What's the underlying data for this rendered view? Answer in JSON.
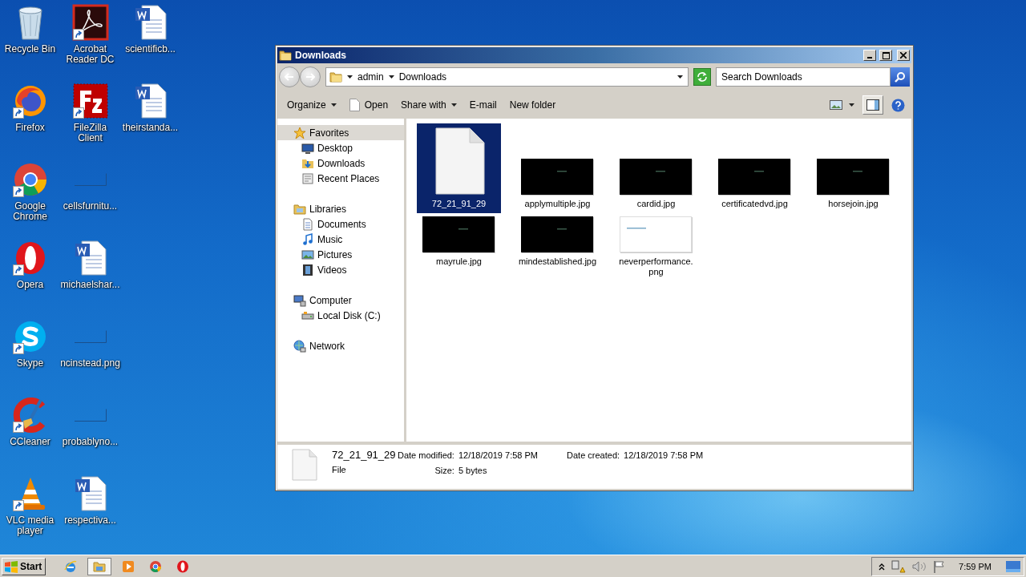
{
  "desktop_icons": [
    {
      "label": "Recycle Bin",
      "kind": "recycle_bin",
      "shortcut": false
    },
    {
      "label": "Firefox",
      "kind": "firefox",
      "shortcut": true
    },
    {
      "label": "Google Chrome",
      "kind": "chrome",
      "shortcut": true
    },
    {
      "label": "Opera",
      "kind": "opera",
      "shortcut": true
    },
    {
      "label": "Skype",
      "kind": "skype",
      "shortcut": true
    },
    {
      "label": "CCleaner",
      "kind": "ccleaner",
      "shortcut": true
    },
    {
      "label": "VLC media player",
      "kind": "vlc",
      "shortcut": true
    },
    {
      "label": "Acrobat Reader DC",
      "kind": "acrobat",
      "shortcut": true
    },
    {
      "label": "FileZilla Client",
      "kind": "filezilla",
      "shortcut": true
    },
    {
      "label": "cellsfurnitu...",
      "kind": "blank_image",
      "shortcut": false
    },
    {
      "label": "michaelshar...",
      "kind": "word",
      "shortcut": false
    },
    {
      "label": "ncinstead.png",
      "kind": "blank_image",
      "shortcut": false
    },
    {
      "label": "probablyno...",
      "kind": "blank_image",
      "shortcut": false
    },
    {
      "label": "respectiva...",
      "kind": "word",
      "shortcut": false
    },
    {
      "label": "scientificb...",
      "kind": "word",
      "shortcut": false
    },
    {
      "label": "theirstanda...",
      "kind": "word",
      "shortcut": false
    }
  ],
  "window": {
    "title": "Downloads",
    "breadcrumb": [
      "admin",
      "Downloads"
    ],
    "search": {
      "placeholder": "Search Downloads"
    },
    "toolbar": [
      {
        "label": "Organize",
        "kind": "menu"
      },
      {
        "label": "Open",
        "kind": "open"
      },
      {
        "label": "Share with",
        "kind": "menu"
      },
      {
        "label": "E-mail",
        "kind": "plain"
      },
      {
        "label": "New folder",
        "kind": "plain"
      }
    ],
    "navigation": [
      {
        "label": "Favorites",
        "kind": "favorites",
        "selected": true,
        "children": [
          {
            "label": "Desktop",
            "kind": "desktop",
            "selected": false
          },
          {
            "label": "Downloads",
            "kind": "downloads",
            "selected": false
          },
          {
            "label": "Recent Places",
            "kind": "recent",
            "selected": false
          }
        ]
      },
      {
        "label": "Libraries",
        "kind": "libraries",
        "selected": false,
        "children": [
          {
            "label": "Documents",
            "kind": "documents",
            "selected": false
          },
          {
            "label": "Music",
            "kind": "music",
            "selected": false
          },
          {
            "label": "Pictures",
            "kind": "pictures",
            "selected": false
          },
          {
            "label": "Videos",
            "kind": "videos",
            "selected": false
          }
        ]
      },
      {
        "label": "Computer",
        "kind": "computer",
        "selected": false,
        "children": [
          {
            "label": "Local Disk (C:)",
            "kind": "disk",
            "selected": false
          }
        ]
      },
      {
        "label": "Network",
        "kind": "network",
        "selected": false
      }
    ],
    "files": [
      {
        "name": "72_21_91_29",
        "kind": "document",
        "selected": true
      },
      {
        "name": "applymultiple.jpg",
        "kind": "dark_image",
        "selected": false
      },
      {
        "name": "cardid.jpg",
        "kind": "dark_image",
        "selected": false
      },
      {
        "name": "certificatedvd.jpg",
        "kind": "dark_image",
        "selected": false
      },
      {
        "name": "horsejoin.jpg",
        "kind": "dark_image",
        "selected": false
      },
      {
        "name": "mayrule.jpg",
        "kind": "dark_image",
        "selected": false
      },
      {
        "name": "mindestablished.jpg",
        "kind": "dark_image",
        "selected": false
      },
      {
        "name": "neverperformance.\npng",
        "kind": "light_image",
        "selected": false
      }
    ],
    "details": {
      "name": "72_21_91_29",
      "type": "File",
      "columns": [
        [
          {
            "label": "Date modified:",
            "value": "12/18/2019 7:58 PM"
          },
          {
            "label": "Size:",
            "value": "5 bytes"
          }
        ],
        [
          {
            "label": "Date created:",
            "value": "12/18/2019 7:58 PM"
          }
        ]
      ]
    }
  },
  "taskbar": {
    "start": "Start",
    "apps": [
      {
        "kind": "ie",
        "active": false
      },
      {
        "kind": "explorer",
        "active": true
      },
      {
        "kind": "media",
        "active": false
      },
      {
        "kind": "chrome",
        "active": false
      },
      {
        "kind": "opera",
        "active": false
      }
    ],
    "clock": "7:59 PM"
  }
}
